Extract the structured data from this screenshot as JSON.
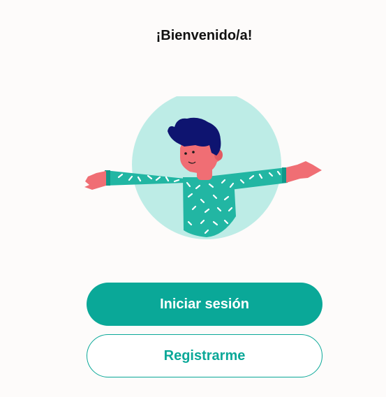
{
  "welcome": {
    "title": "¡Bienvenido/a!"
  },
  "illustration": {
    "name": "welcome-person-illustration"
  },
  "actions": {
    "login_label": "Iniciar sesión",
    "register_label": "Registrarme"
  },
  "colors": {
    "accent": "#0aa898",
    "circle": "#bdece6",
    "skin": "#f06e74",
    "hair": "#0e1470",
    "background": "#fdfbfa"
  }
}
